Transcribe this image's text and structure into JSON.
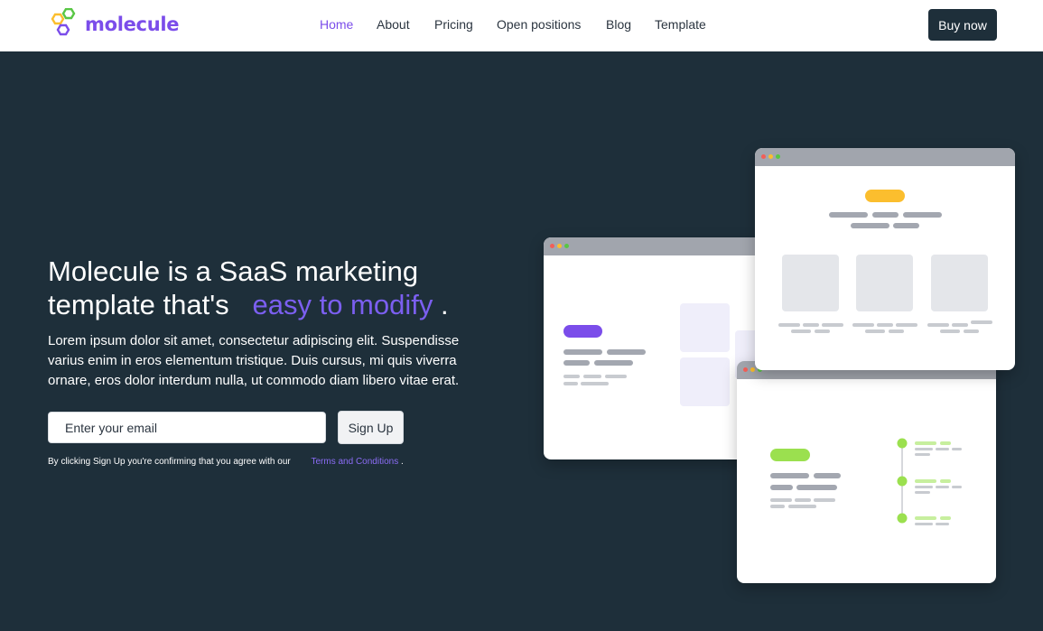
{
  "header": {
    "brand": "molecule",
    "nav": [
      {
        "label": "Home",
        "active": true
      },
      {
        "label": "About",
        "active": false
      },
      {
        "label": "Pricing",
        "active": false
      },
      {
        "label": "Open positions",
        "active": false
      },
      {
        "label": "Blog",
        "active": false
      },
      {
        "label": "Template",
        "active": false
      }
    ],
    "cta_label": "Buy now"
  },
  "hero": {
    "title_part1": "Molecule is a SaaS marketing template that's",
    "title_accent": "easy to modify",
    "title_end": ".",
    "description": "Lorem ipsum dolor sit amet, consectetur adipiscing elit. Suspendisse varius enim in eros elementum tristique. Duis cursus, mi quis viverra ornare, eros dolor interdum nulla, ut commodo diam libero vitae erat.",
    "email_placeholder": "Enter your email",
    "signup_label": "Sign Up",
    "consent_text": "By clicking Sign Up you're confirming that you agree with our",
    "terms_label": "Terms and Conditions",
    "consent_end": "."
  },
  "colors": {
    "brand": "#7b4dea",
    "background": "#1e2f3a",
    "accent_text": "#7b5ff0",
    "mockup_purple": "#7b4dea",
    "mockup_yellow": "#fbbe2e",
    "mockup_green": "#9be04f"
  },
  "icons": {
    "logo": "hexagon-molecule-icon"
  }
}
